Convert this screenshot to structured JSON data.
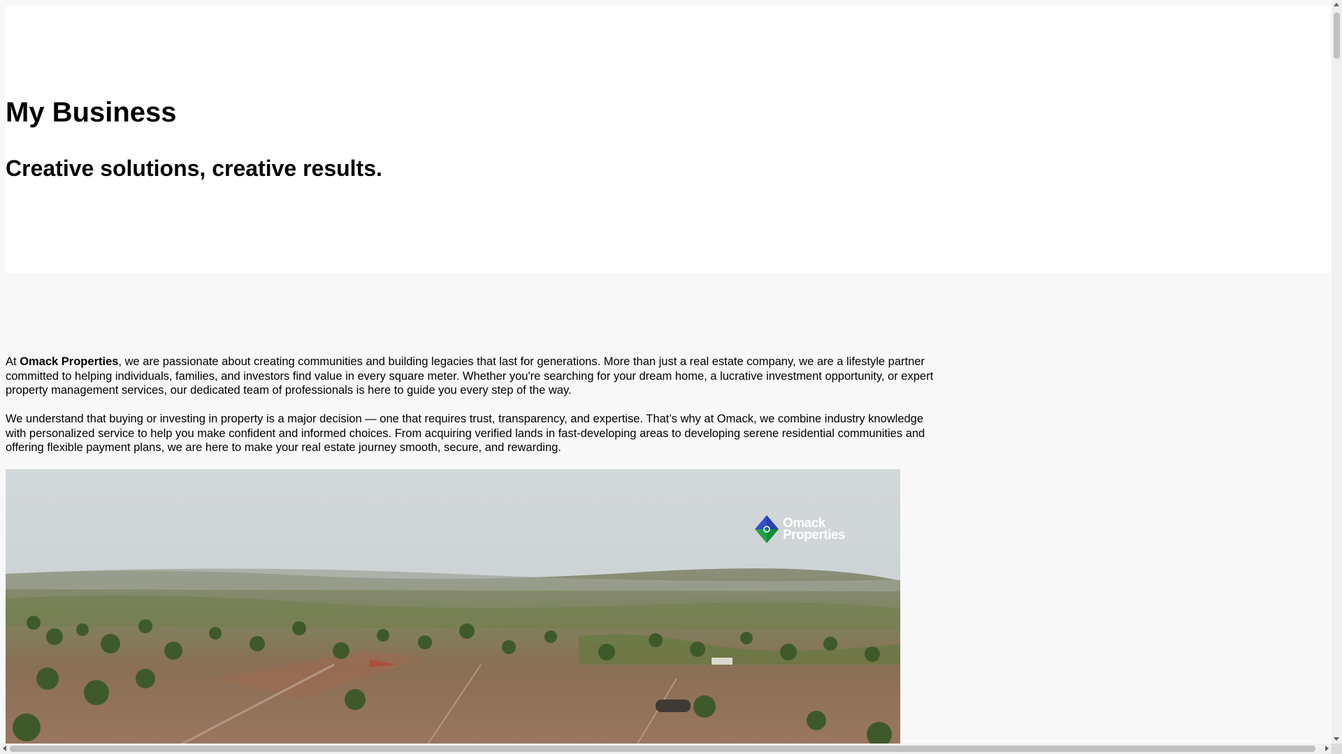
{
  "header": {
    "site_title": "My Business",
    "tagline": "Creative solutions, creative results."
  },
  "about": {
    "p1_prefix": "At ",
    "company_name": "Omack Properties",
    "p1_rest": ", we are passionate about creating communities and building legacies that last for generations. More than just a real estate company, we are a lifestyle partner committed to helping individuals, families, and investors find value in every square meter. Whether you're searching for your dream home, a lucrative investment opportunity, or expert property management services, our dedicated team of professionals is here to guide you every step of the way.",
    "p2": "We understand that buying or investing in property is a major decision — one that requires trust, transparency, and expertise. That’s why at Omack, we combine industry knowledge with personalized service to help you make confident and informed choices. From acquiring verified lands in fast-developing areas to developing serene residential communities and offering flexible payment plans, we are here to make your real estate journey smooth, secure, and rewarding."
  },
  "media": {
    "logo_text": "Omack Properties",
    "logo_colors": {
      "blue": "#2a3fb0",
      "green": "#1fa24a"
    }
  },
  "scrollbars": {
    "vertical_position": 0.0,
    "horizontal_position": 0.0
  }
}
